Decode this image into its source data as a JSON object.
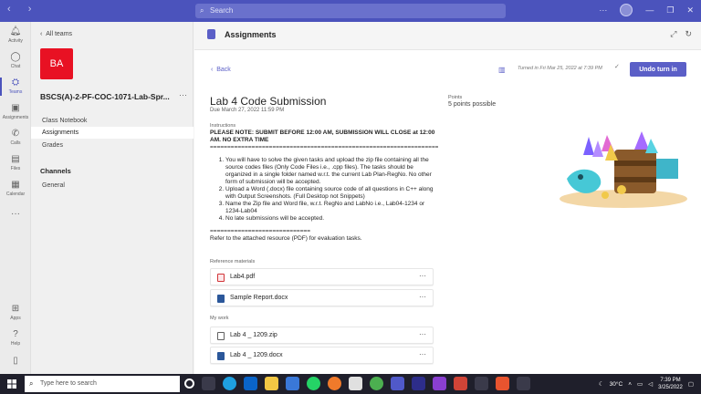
{
  "titlebar": {
    "search_placeholder": "Search"
  },
  "rail": {
    "items": [
      {
        "label": "Activity",
        "icon": "bell-icon"
      },
      {
        "label": "Chat",
        "icon": "chat-icon"
      },
      {
        "label": "Teams",
        "icon": "teams-icon"
      },
      {
        "label": "Assignments",
        "icon": "backpack-icon"
      },
      {
        "label": "Calls",
        "icon": "phone-icon"
      },
      {
        "label": "Files",
        "icon": "file-icon"
      },
      {
        "label": "Calendar",
        "icon": "calendar-icon"
      },
      {
        "label": "···",
        "icon": "more-icon"
      },
      {
        "label": "Apps",
        "icon": "apps-icon"
      },
      {
        "label": "Help",
        "icon": "help-icon"
      }
    ]
  },
  "team": {
    "all_teams": "All teams",
    "initials": "BA",
    "name": "BSCS(A)-2-PF-COC-1071-Lab-Spr...",
    "nav": [
      "Class Notebook",
      "Assignments",
      "Grades"
    ],
    "channels_heading": "Channels",
    "channels": [
      "General"
    ]
  },
  "header": {
    "title": "Assignments"
  },
  "assignment": {
    "back": "Back",
    "turned_in": "Turned in Fri Mar 25, 2022 at 7:39 PM",
    "undo_button": "Undo turn in",
    "title": "Lab 4 Code Submission",
    "due": "Due March 27, 2022 11:59 PM",
    "points_label": "Points",
    "points_value": "5 points possible",
    "instructions_label": "Instructions",
    "notice": "PLEASE NOTE: SUBMIT BEFORE 12:00 AM,  SUBMISSION WILL CLOSE at 12:00 AM. NO EXTRA TIME",
    "separator1": "==========================================================================",
    "steps": [
      "You will have to solve the given tasks and upload the zip file containing all the source codes files (Only Code Files i.e., .cpp files). The tasks should be organized in a single folder named w.r.t. the current Lab Plan-RegNo. No other form of submission will be accepted.",
      "Upload a Word (.docx) file containing source code of all questions in C++ along with Output Screenshots. (Full Desktop not Snippets)",
      "Name the Zip file and Word file, w.r.t. RegNo and LabNo i.e., Lab04-1234 or 1234-Lab04",
      "No late submissions will be accepted."
    ],
    "separator2": "=============================",
    "footer_note": "Refer to the attached resource (PDF) for evaluation tasks.",
    "reference_label": "Reference materials",
    "reference_files": [
      "Lab4.pdf",
      "Sample Report.docx"
    ],
    "mywork_label": "My work",
    "mywork_files": [
      "Lab 4 _ 1209.zip",
      "Lab 4 _ 1209.docx"
    ],
    "more": "···"
  },
  "taskbar": {
    "search_placeholder": "Type here to search",
    "temperature": "30°C",
    "time": "7:39 PM",
    "date": "3/25/2022"
  }
}
